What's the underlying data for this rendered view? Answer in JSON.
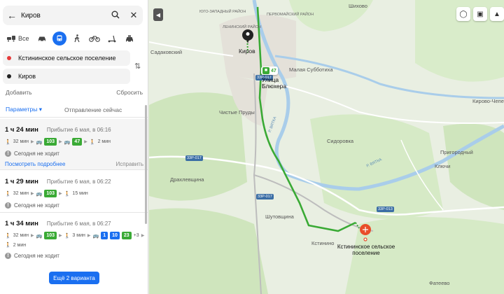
{
  "search": {
    "query": "Киров",
    "back_icon": "arrow-left-icon",
    "search_icon": "search-icon",
    "close_icon": "close-icon"
  },
  "modes": {
    "all_label": "Все",
    "items": [
      "car-icon",
      "bus-icon",
      "walk-icon",
      "bicycle-icon",
      "scooter-icon",
      "taxi-icon"
    ],
    "active": "bus-icon"
  },
  "points": {
    "from": "Кстининское сельское поселение",
    "to": "Киров"
  },
  "actions": {
    "add": "Добавить",
    "reset": "Сбросить"
  },
  "params": {
    "label": "Параметры",
    "depart": "Отправление сейчас"
  },
  "routes": [
    {
      "duration": "1 ч 24 мин",
      "arrival": "Прибытие 6 мая, в 06:16",
      "walk1": "32 мин",
      "bus1": "103",
      "bus2": "47",
      "walk2": "2 мин",
      "warning": "Сегодня не ходит",
      "details": "Посмотреть подробнее",
      "fix": "Исправить"
    },
    {
      "duration": "1 ч 29 мин",
      "arrival": "Прибытие 6 мая, в 06:22",
      "walk1": "32 мин",
      "bus1": "103",
      "walk2": "15 мин",
      "warning": "Сегодня не ходит"
    },
    {
      "duration": "1 ч 34 мин",
      "arrival": "Прибытие 6 мая, в 06:27",
      "walk1": "32 мин",
      "bus1": "103",
      "walk2": "3 мин",
      "bus2a": "1",
      "bus2b": "10",
      "bus2c": "23",
      "more": "+3",
      "walk3": "2 мин",
      "warning": "Сегодня не ходит"
    }
  ],
  "more_button": "Ещё 2 варианта",
  "map": {
    "labels": {
      "shikhovo": "Шихово",
      "yuzhny": "ЮГО-ЗАПАДНЫЙ РАЙОН",
      "pervomaysky": "ПЕРВОМАЙСКИЙ РАЙОН",
      "leninsky": "ЛЕНИНСКИЙ РАЙОН",
      "sadakovsky": "Садаковский",
      "malaya": "Малая Субботиха",
      "kirovchep": "Кирово-Чепецк",
      "chistye": "Чистые Пруды",
      "sidorovka": "Сидоровка",
      "prigorodny": "Пригородный",
      "klyuchi": "Ключи",
      "drakhl": "Драхлевщина",
      "shutovshina": "Шутовщина",
      "kstinino": "Кстинино",
      "fateevo": "Фатеево",
      "vyatka1": "р. Вятка",
      "vyatka2": "р. Вятка"
    },
    "roads": {
      "r1": "33Р-017",
      "r2": "33Р-017",
      "r3": "33Р-017",
      "r4": "33Р-013"
    },
    "origin_label": "Киров",
    "stop_label": "Улица Блюхера",
    "bus_number": "47",
    "dest_label": "Кстининское сельское поселение",
    "route_color": "#3aaa35",
    "accent": "#1a6ff0"
  }
}
